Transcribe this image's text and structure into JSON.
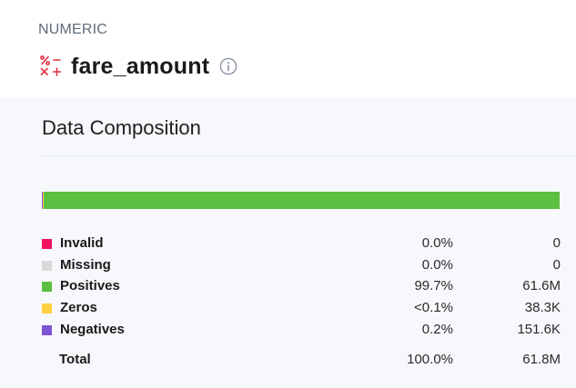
{
  "header": {
    "type_label": "NUMERIC",
    "field_name": "fare_amount",
    "type_icon": "numeric-operators-icon",
    "info_icon": "info-icon"
  },
  "composition": {
    "title": "Data Composition",
    "bar_fractions": {
      "negatives": 0.002,
      "zeros": 0.001,
      "positives": 0.997
    },
    "rows": [
      {
        "label": "Invalid",
        "pct": "0.0%",
        "count": "0",
        "color": "#f0135f"
      },
      {
        "label": "Missing",
        "pct": "0.0%",
        "count": "0",
        "color": "#d9d9d9"
      },
      {
        "label": "Positives",
        "pct": "99.7%",
        "count": "61.6M",
        "color": "#5bbf41"
      },
      {
        "label": "Zeros",
        "pct": "<0.1%",
        "count": "38.3K",
        "color": "#ffcf3f"
      },
      {
        "label": "Negatives",
        "pct": "0.2%",
        "count": "151.6K",
        "color": "#7d55d6"
      }
    ],
    "total": {
      "label": "Total",
      "pct": "100.0%",
      "count": "61.8M"
    }
  }
}
